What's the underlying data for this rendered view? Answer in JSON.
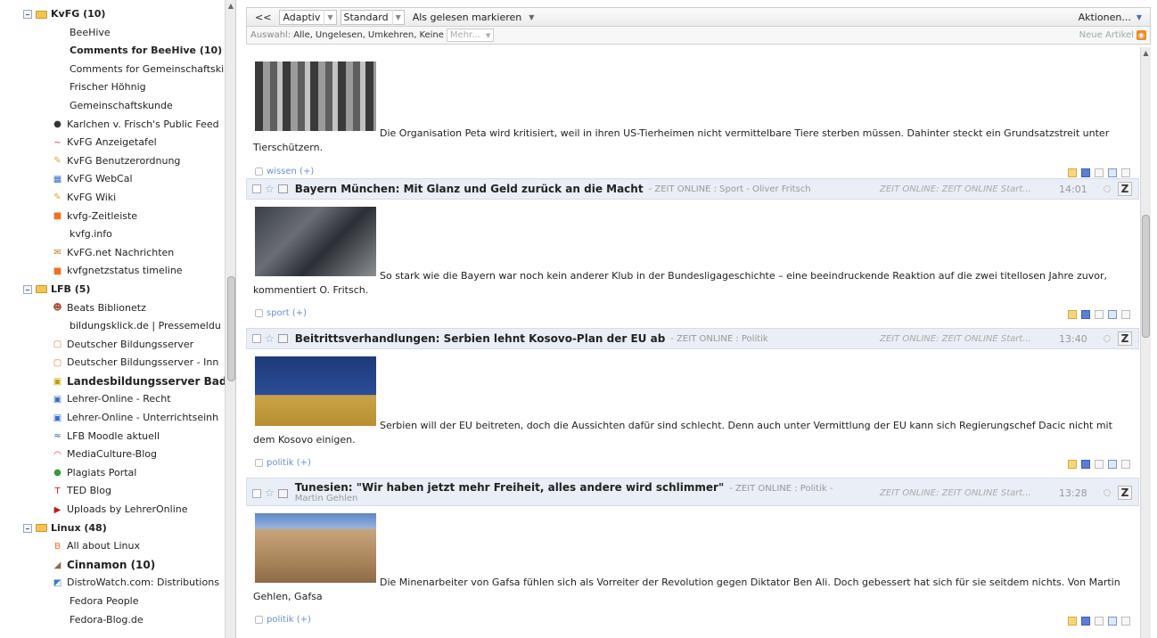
{
  "sidebar": {
    "items": [
      {
        "label": "KvFG (10)",
        "kind": "folder"
      },
      {
        "label": "BeeHive",
        "kind": "feed-noicon"
      },
      {
        "label": "Comments for BeeHive (10)",
        "kind": "feed-noicon",
        "bold": true
      },
      {
        "label": "Comments for Gemeinschaftski",
        "kind": "feed-noicon"
      },
      {
        "label": "Frischer Höhnig",
        "kind": "feed-noicon"
      },
      {
        "label": "Gemeinschaftskunde",
        "kind": "feed-noicon"
      },
      {
        "label": "Karlchen v. Frisch's Public Feed",
        "kind": "feed",
        "icon": "github-icon"
      },
      {
        "label": "KvFG Anzeigetafel",
        "kind": "feed",
        "icon": "tilde-icon"
      },
      {
        "label": "KvFG Benutzerordnung",
        "kind": "feed",
        "icon": "wiki-icon"
      },
      {
        "label": "KvFG WebCal",
        "kind": "feed",
        "icon": "calendar-icon"
      },
      {
        "label": "KvFG Wiki",
        "kind": "feed",
        "icon": "wiki-icon"
      },
      {
        "label": "kvfg-Zeitleiste",
        "kind": "feed",
        "icon": "rss-square-icon"
      },
      {
        "label": "kvfg.info",
        "kind": "feed-noicon"
      },
      {
        "label": "KvFG.net Nachrichten",
        "kind": "feed",
        "icon": "news-icon"
      },
      {
        "label": "kvfgnetzstatus timeline",
        "kind": "feed",
        "icon": "rss-square-icon"
      },
      {
        "label": "LFB (5)",
        "kind": "folder"
      },
      {
        "label": "Beats Biblionetz",
        "kind": "feed",
        "icon": "person-icon"
      },
      {
        "label": "bildungsklick.de | Pressemeldu",
        "kind": "feed-noicon"
      },
      {
        "label": "Deutscher Bildungsserver",
        "kind": "feed",
        "icon": "page-icon"
      },
      {
        "label": "Deutscher Bildungsserver - Inn",
        "kind": "feed",
        "icon": "page-icon"
      },
      {
        "label": "Landesbildungsserver Bade",
        "kind": "feed",
        "icon": "lbs-icon",
        "bold": true,
        "big": true
      },
      {
        "label": "Lehrer-Online - Recht",
        "kind": "feed",
        "icon": "lo-icon"
      },
      {
        "label": "Lehrer-Online - Unterrichtseinh",
        "kind": "feed",
        "icon": "lo-icon"
      },
      {
        "label": "LFB Moodle aktuell",
        "kind": "feed",
        "icon": "moodle-icon"
      },
      {
        "label": "MediaCulture-Blog",
        "kind": "feed",
        "icon": "wave-icon"
      },
      {
        "label": "Plagiats Portal",
        "kind": "feed",
        "icon": "green-dot-icon"
      },
      {
        "label": "TED Blog",
        "kind": "feed",
        "icon": "ted-icon"
      },
      {
        "label": "Uploads by LehrerOnline",
        "kind": "feed",
        "icon": "youtube-icon"
      },
      {
        "label": "Linux (48)",
        "kind": "folder"
      },
      {
        "label": "All about Linux",
        "kind": "feed",
        "icon": "blogger-icon"
      },
      {
        "label": "Cinnamon (10)",
        "kind": "feed",
        "icon": "cinnamon-icon",
        "bold": true,
        "big": true
      },
      {
        "label": "DistroWatch.com: Distributions",
        "kind": "feed",
        "icon": "distrowatch-icon"
      },
      {
        "label": "Fedora People",
        "kind": "feed-noicon"
      },
      {
        "label": "Fedora-Blog.de",
        "kind": "feed-noicon"
      }
    ]
  },
  "toolbar": {
    "back": "<<",
    "mode": "Adaptiv",
    "order": "Standard",
    "mark_read": "Als gelesen markieren",
    "actions": "Aktionen..."
  },
  "selection": {
    "prefix": "Auswahl:",
    "all": "Alle,",
    "unread": "Ungelesen,",
    "invert": "Umkehren,",
    "none": "Keine",
    "more": "Mehr...",
    "new_articles": "Neue Artikel"
  },
  "articles": [
    {
      "title": "",
      "source": "",
      "feed": "",
      "time": "",
      "text": "Die Organisation Peta wird kritisiert, weil in ihren US-Tierheimen nicht vermittelbare Tiere sterben müssen. Dahinter steckt ein Grundsatzstreit unter Tierschützern.",
      "tag": "wissen (+)"
    },
    {
      "title": "Bayern München: Mit Glanz und Geld zurück an die Macht",
      "source": "- ZEIT ONLINE : Sport - Oliver Fritsch",
      "feed": "ZEIT ONLINE: ZEIT ONLINE Start...",
      "time": "14:01",
      "text": "So stark wie die Bayern war noch kein anderer Klub in der Bundesligageschichte – eine beeindruckende Reaktion auf die zwei titellosen Jahre zuvor, kommentiert O. Fritsch.",
      "tag": "sport (+)"
    },
    {
      "title": "Beitrittsverhandlungen: Serbien lehnt Kosovo-Plan der EU ab",
      "source": "- ZEIT ONLINE : Politik",
      "feed": "ZEIT ONLINE: ZEIT ONLINE Start...",
      "time": "13:40",
      "text": "Serbien will der EU beitreten, doch die Aussichten dafür sind schlecht. Denn auch unter Vermittlung der EU kann sich Regierungschef Dacic nicht mit dem Kosovo einigen.",
      "tag": "politik (+)"
    },
    {
      "title": "Tunesien: \"Wir haben jetzt mehr Freiheit, alles andere wird schlimmer\"",
      "source": "- ZEIT ONLINE : Politik -",
      "source2": "Martin Gehlen",
      "feed": "ZEIT ONLINE: ZEIT ONLINE Start...",
      "time": "13:28",
      "text": "Die Minenarbeiter von Gafsa fühlen sich als Vorreiter der Revolution gegen Diktator Ben Ali. Doch gebessert hat sich für sie seitdem nichts. Von Martin Gehlen, Gafsa",
      "tag": "politik (+)"
    }
  ],
  "z_label": "Z"
}
